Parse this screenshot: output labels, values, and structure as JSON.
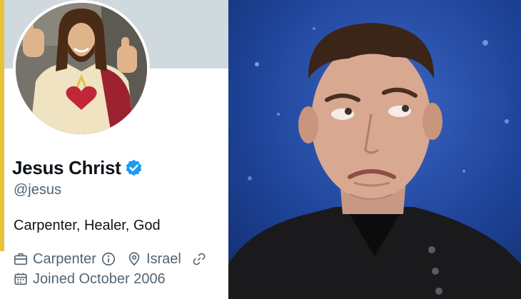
{
  "profile": {
    "display_name": "Jesus Christ",
    "handle": "@jesus",
    "bio": "Carpenter, Healer, God",
    "profession": "Carpenter",
    "location": "Israel",
    "joined": "Joined October 2006",
    "icons": {
      "verified": "verified-badge-icon",
      "profession": "briefcase-icon",
      "info": "info-icon",
      "location": "location-pin-icon",
      "link": "link-icon",
      "calendar": "calendar-icon"
    }
  },
  "colors": {
    "verified_blue": "#1d9bf0",
    "text_primary": "#0f1419",
    "text_secondary": "#536471",
    "banner": "#cfd9de",
    "photo_background": "#1c3f8c"
  }
}
